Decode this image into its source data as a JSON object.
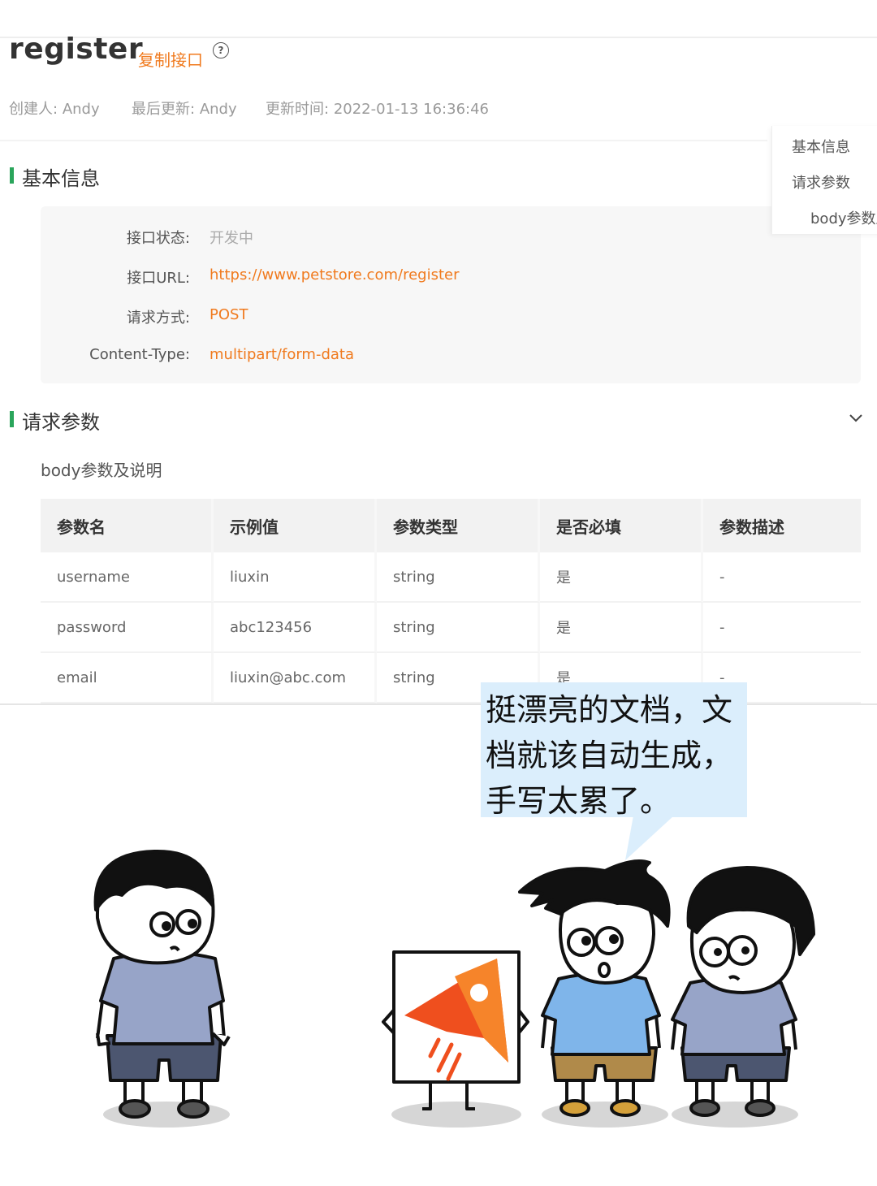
{
  "header": {
    "api_name": "register",
    "copy_link": "复制接口",
    "help_icon": "question-circle-icon",
    "creator_label": "创建人:",
    "creator": "Andy",
    "last_update_label": "最后更新:",
    "last_updater": "Andy",
    "update_time_label": "更新时间:",
    "update_time": "2022-01-13 16:36:46"
  },
  "basic_info": {
    "title": "基本信息",
    "rows": [
      {
        "label": "接口状态:",
        "value": "开发中"
      },
      {
        "label": "接口URL:",
        "value": "https://www.petstore.com/register"
      },
      {
        "label": "请求方式:",
        "value": "POST"
      },
      {
        "label": "Content-Type:",
        "value": "multipart/form-data"
      }
    ]
  },
  "toc": {
    "items": [
      "基本信息",
      "请求参数",
      "body参数及"
    ]
  },
  "request_params": {
    "title": "请求参数",
    "collapse_icon": "chevron-down-icon",
    "body_subtitle": "body参数及说明",
    "columns": [
      "参数名",
      "示例值",
      "参数类型",
      "是否必填",
      "参数描述"
    ],
    "rows": [
      [
        "username",
        "liuxin",
        "string",
        "是",
        "-"
      ],
      [
        "password",
        "abc123456",
        "string",
        "是",
        "-"
      ],
      [
        "email",
        "liuxin@abc.com",
        "string",
        "是",
        "-"
      ]
    ]
  },
  "comic": {
    "speech": "挺漂亮的文档，文档就该自动生成，手写太累了。"
  },
  "colors": {
    "accent": "#f07a1e",
    "section_bar": "#2aa55b",
    "bubble": "#dbeefc",
    "shirt_grey": "#97a4c8",
    "shirt_blue": "#7fb5ea"
  }
}
